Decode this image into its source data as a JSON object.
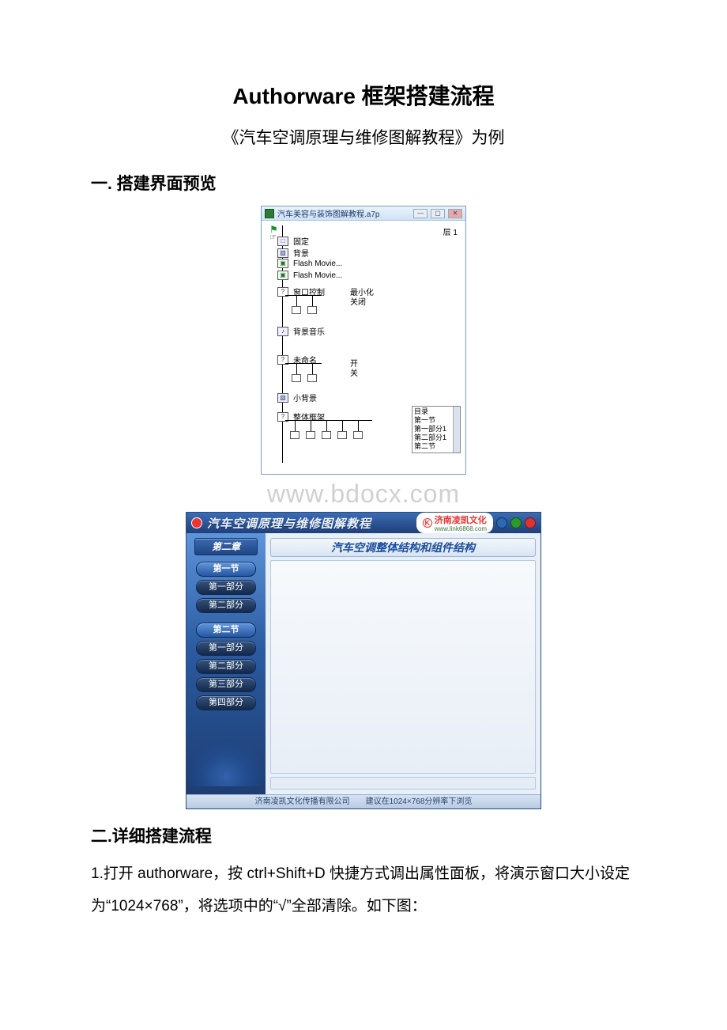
{
  "doc": {
    "title": "Authorware 框架搭建流程",
    "subtitle": "《汽车空调原理与维修图解教程》为例",
    "section1": "一. 搭建界面预览",
    "section2": "二.详细搭建流程",
    "para1": "1.打开 authorware，按 ctrl+Shift+D 快捷方式调出属性面板，将演示窗口大小设定为“1024×768”，将选项中的“√”全部清除。如下图：",
    "watermark": "www.bdocx.com"
  },
  "aw": {
    "title": "汽车美容与装饰图解教程.a7p",
    "layer": "层 1",
    "nodes": {
      "n1": "固定",
      "n2": "背景",
      "n3": "Flash Movie...",
      "n4": "Flash Movie...",
      "n5": "窗口控制",
      "n5a": "最小化",
      "n5b": "关闭",
      "n6": "背景音乐",
      "n7": "未命名",
      "n7a": "开",
      "n7b": "关",
      "n8": "小背景",
      "n9": "整体框架"
    },
    "list": [
      "目录",
      "第一节",
      "第一部分1",
      "第二部分1",
      "第二节"
    ]
  },
  "app": {
    "title": "汽车空调原理与维修图解教程",
    "brand": "济南凌凯文化",
    "brand_url": "www.link6868.com",
    "chapter": "第二章",
    "pane_title": "汽车空调整体结构和组件结构",
    "nav": {
      "s1": "第一节",
      "s1p1": "第一部分",
      "s1p2": "第二部分",
      "s2": "第二节",
      "s2p1": "第一部分",
      "s2p2": "第二部分",
      "s2p3": "第三部分",
      "s2p4": "第四部分"
    },
    "footer": "济南凌凯文化传播有限公司　　建议在1024×768分辨率下浏览"
  }
}
